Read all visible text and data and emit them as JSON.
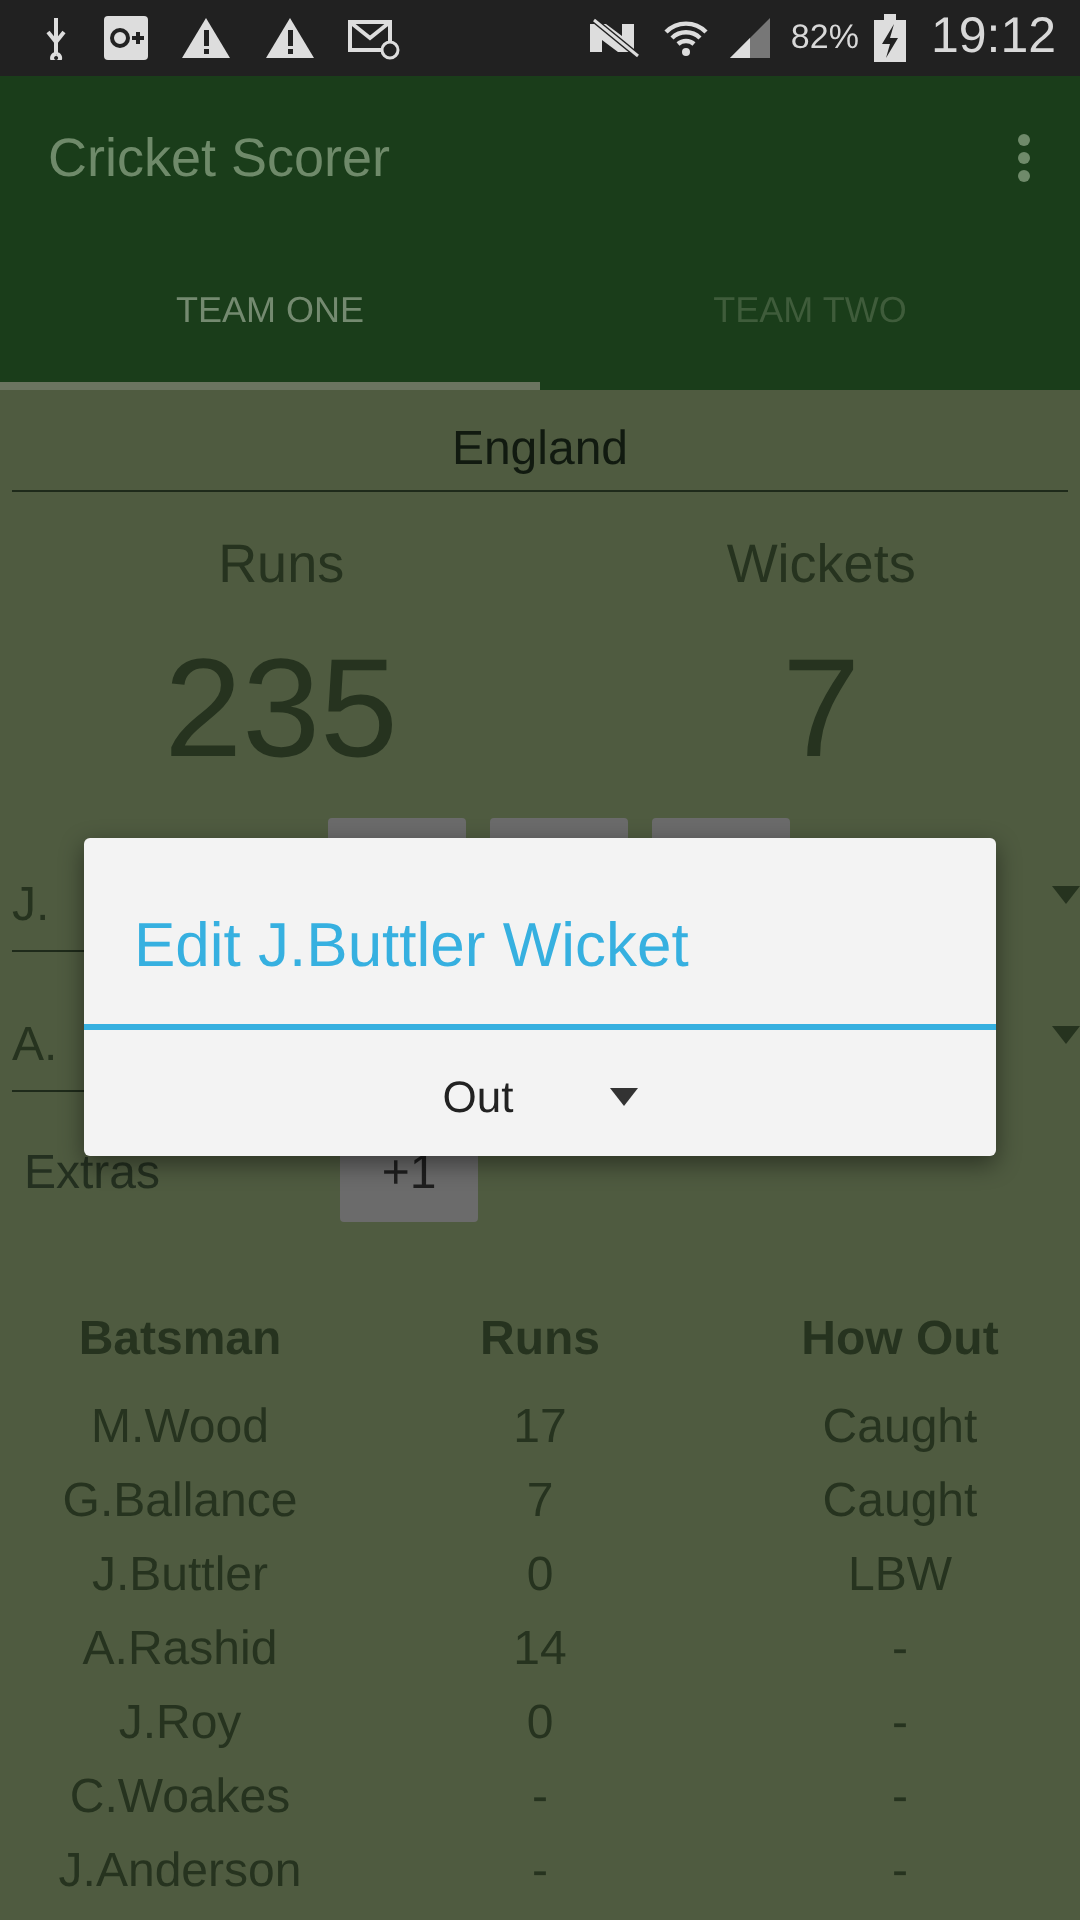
{
  "status_bar": {
    "battery": "82%",
    "time": "19:12"
  },
  "app_bar": {
    "title": "Cricket Scorer"
  },
  "tabs": [
    {
      "label": "TEAM ONE",
      "selected": true
    },
    {
      "label": "TEAM TWO",
      "selected": false
    }
  ],
  "team_name": "England",
  "score": {
    "runs_label": "Runs",
    "runs": "235",
    "wickets_label": "Wickets",
    "wickets": "7"
  },
  "batsmen": [
    {
      "name": "J."
    },
    {
      "name": "A."
    }
  ],
  "extras": {
    "label": "Extras",
    "button": "+1"
  },
  "dialog": {
    "title": "Edit J.Buttler Wicket",
    "value": "Out"
  },
  "table": {
    "columns": [
      "Batsman",
      "Runs",
      "How Out"
    ],
    "rows": [
      [
        "M.Wood",
        "17",
        "Caught"
      ],
      [
        "G.Ballance",
        "7",
        "Caught"
      ],
      [
        "J.Buttler",
        "0",
        "LBW"
      ],
      [
        "A.Rashid",
        "14",
        "-"
      ],
      [
        "J.Roy",
        "0",
        "-"
      ],
      [
        "C.Woakes",
        "-",
        "-"
      ],
      [
        "J.Anderson",
        "-",
        "-"
      ]
    ]
  }
}
